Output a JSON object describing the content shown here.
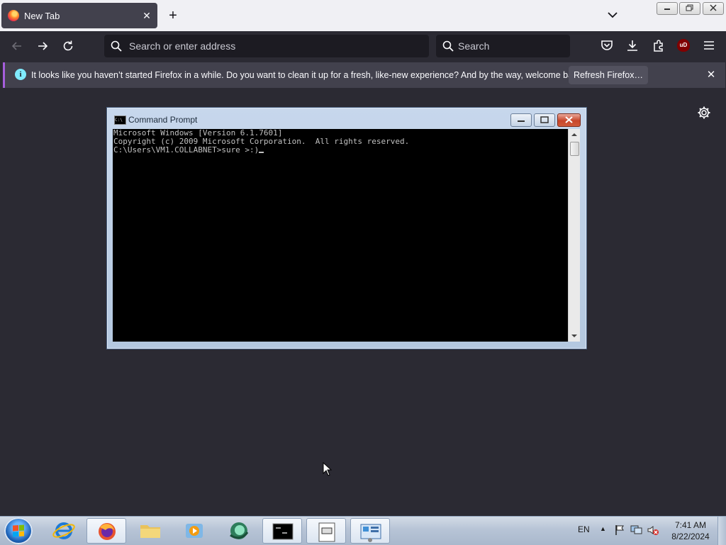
{
  "browser": {
    "tab": {
      "title": "New Tab",
      "close": "✕"
    },
    "new_tab_symbol": "+",
    "urlbar": {
      "placeholder": "Search or enter address"
    },
    "searchbar": {
      "placeholder": "Search"
    },
    "ublock_badge": "uD",
    "notification": {
      "message": "It looks like you haven’t started Firefox in a while. Do you want to clean it up for a fresh, like-new experience? And by the way, welcome back!",
      "button_label": "Refresh Firefox…",
      "close": "✕",
      "info_symbol": "i"
    },
    "icons": [
      "firefox-icon",
      "back-icon",
      "forward-icon",
      "reload-icon",
      "search-icon",
      "pocket-icon",
      "downloads-icon",
      "extensions-icon",
      "ublock-icon",
      "menu-icon",
      "settings-icon"
    ]
  },
  "cmd_window": {
    "title": "Command Prompt",
    "icon_text": "C:\\",
    "lines": [
      "Microsoft Windows [Version 6.1.7601]",
      "Copyright (c) 2009 Microsoft Corporation.  All rights reserved.",
      "",
      "C:\\Users\\VM1.COLLABNET>sure >:)"
    ]
  },
  "taskbar": {
    "items": [
      "start",
      "internet-explorer",
      "firefox",
      "file-explorer",
      "media-player",
      "browser-app",
      "command-prompt",
      "app-window",
      "control-panel"
    ],
    "active": [
      "firefox",
      "command-prompt",
      "app-window",
      "control-panel"
    ],
    "lang": "EN",
    "tray_expand": "▲",
    "time": "7:41 AM",
    "date": "8/22/2024"
  },
  "colors": {
    "firefox_bg": "#2b2a33",
    "accent_purple": "#a55edc",
    "info_cyan": "#80ebff",
    "cmd_bg": "#000000",
    "cmd_text": "#c0c0c0"
  }
}
